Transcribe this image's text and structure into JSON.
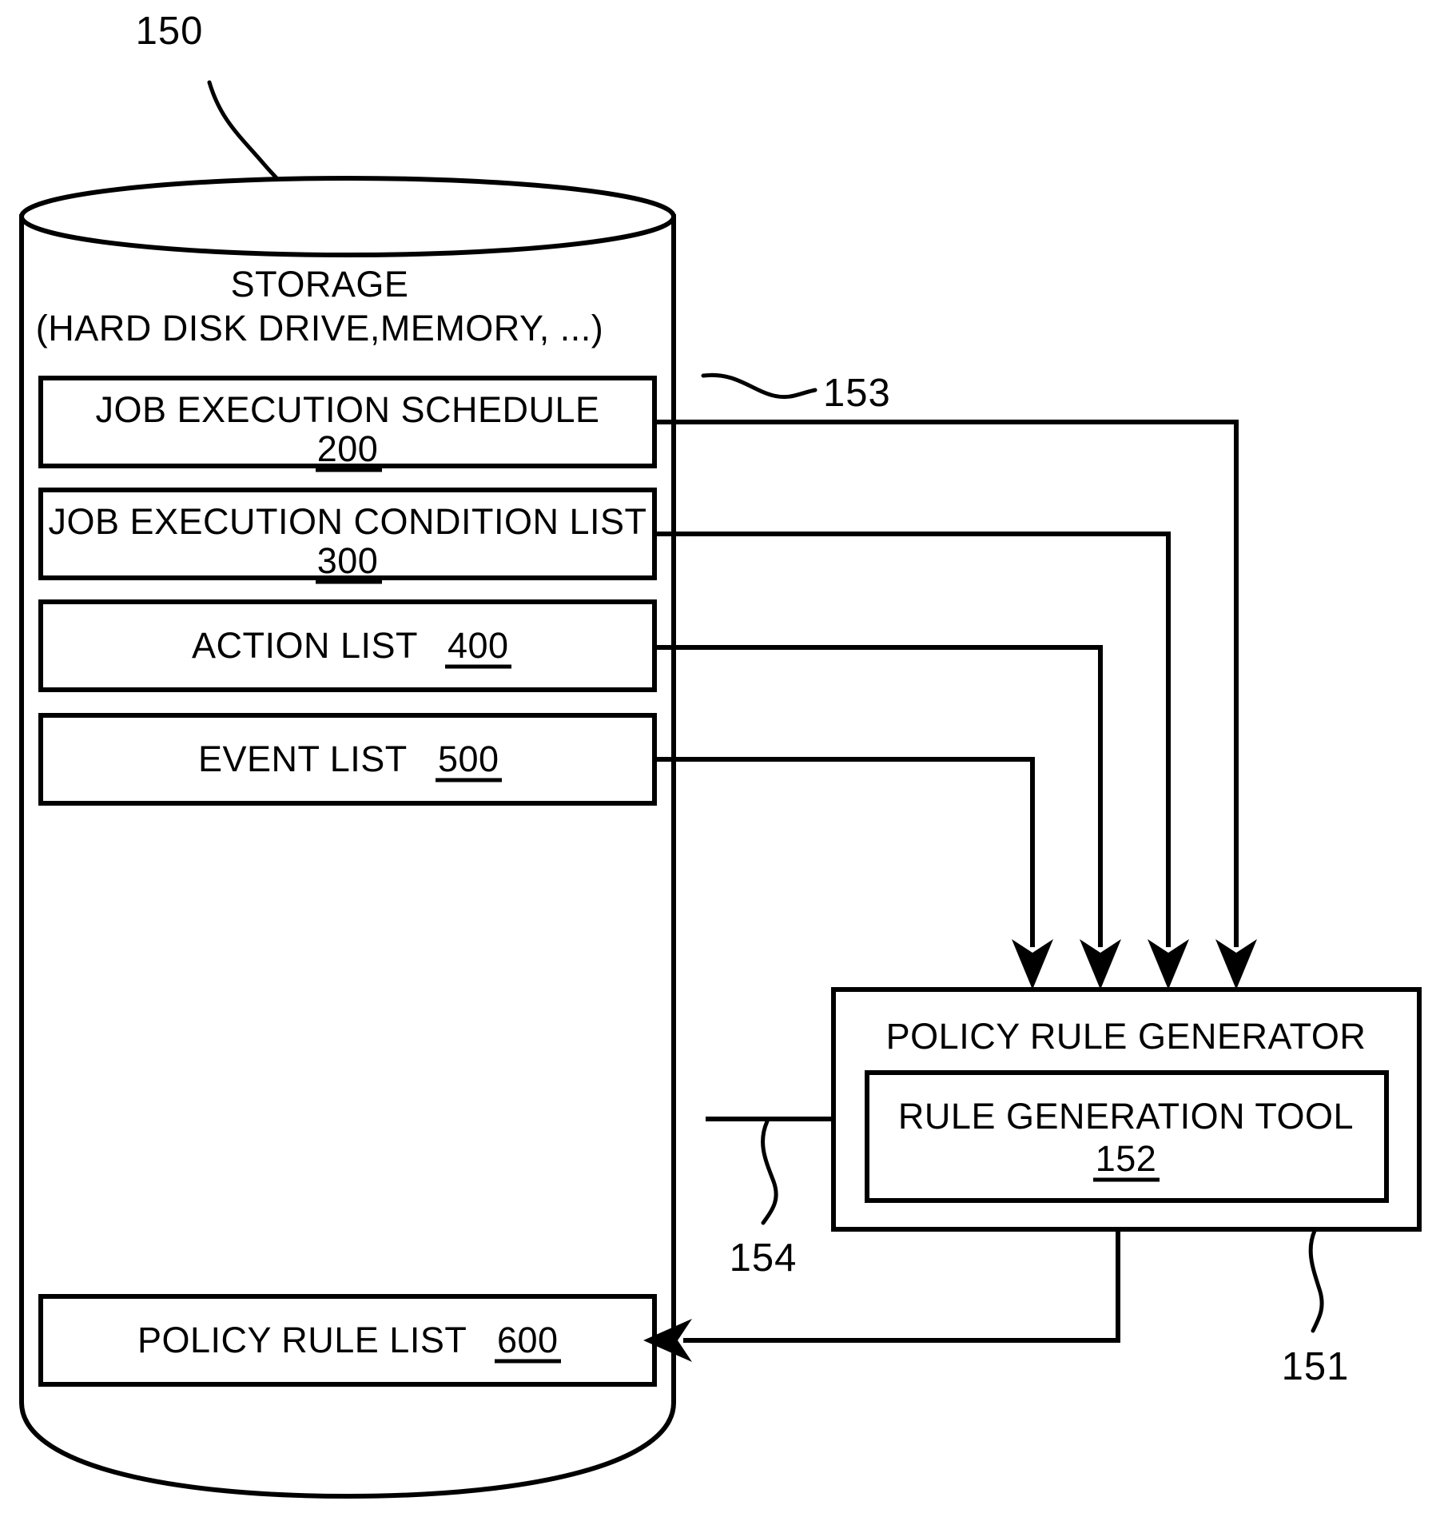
{
  "figure": {
    "title_ref": "150",
    "storage": {
      "line1": "STORAGE",
      "line2": "(HARD DISK DRIVE,MEMORY, ...)",
      "ref": "153"
    },
    "storage_items": [
      {
        "label": "JOB EXECUTION SCHEDULE",
        "ref": "200",
        "layout": "two-line"
      },
      {
        "label": "JOB EXECUTION CONDITION LIST",
        "ref": "300",
        "layout": "two-line"
      },
      {
        "label": "ACTION LIST",
        "ref": "400",
        "layout": "inline"
      },
      {
        "label": "EVENT LIST",
        "ref": "500",
        "layout": "inline"
      }
    ],
    "policy_rule_list": {
      "label": "POLICY RULE LIST",
      "ref": "600",
      "layout": "inline"
    },
    "generator": {
      "label": "POLICY RULE GENERATOR",
      "ref": "151",
      "tool": {
        "label": "RULE GENERATION TOOL",
        "ref": "152"
      }
    },
    "connection_ref": "154",
    "colors": {
      "ink": "#000000",
      "paper": "#ffffff"
    }
  }
}
